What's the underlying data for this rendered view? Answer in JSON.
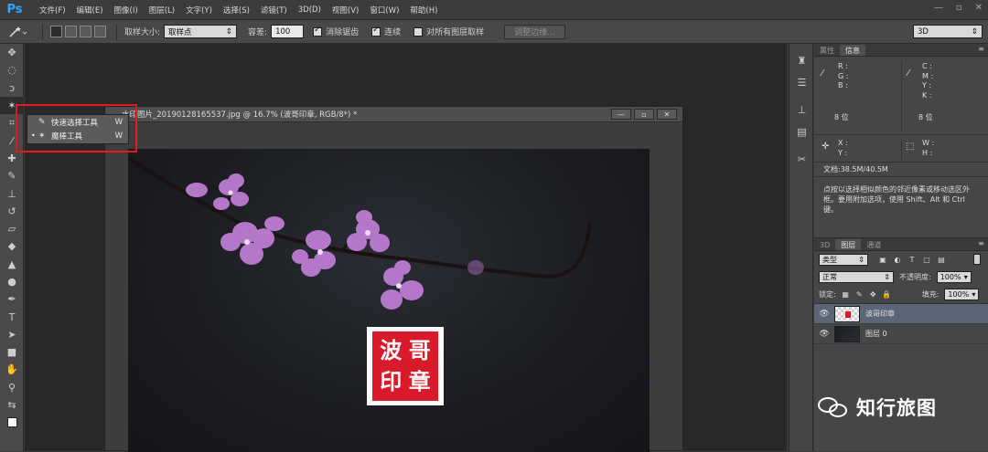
{
  "app": {
    "logo": "Ps"
  },
  "menubar": {
    "items": [
      "文件(F)",
      "编辑(E)",
      "图像(I)",
      "图层(L)",
      "文字(Y)",
      "选择(S)",
      "滤镜(T)",
      "3D(D)",
      "视图(V)",
      "窗口(W)",
      "帮助(H)"
    ],
    "window_controls": {
      "minimize": "—",
      "restore": "▫",
      "close": "✕"
    }
  },
  "options_bar": {
    "tool_icon": "magic-wand-icon",
    "sample_size_label": "取样大小:",
    "sample_size_value": "取样点",
    "tolerance_label": "容差:",
    "tolerance_value": "100",
    "anti_alias_label": "消除锯齿",
    "anti_alias_checked": true,
    "contiguous_label": "连续",
    "contiguous_checked": true,
    "sample_all_layers_label": "对所有图层取样",
    "sample_all_layers_checked": false,
    "refine_edge_label": "调整边缘...",
    "workspace_value": "3D"
  },
  "tool_flyout": {
    "items": [
      {
        "label": "快速选择工具",
        "shortcut": "W",
        "icon": "quick-selection-icon",
        "selected": false
      },
      {
        "label": "魔棒工具",
        "shortcut": "W",
        "icon": "magic-wand-icon",
        "selected": true
      }
    ]
  },
  "document": {
    "title": "水印图片_20190128165537.jpg @ 16.7% (波哥印章, RGB/8*) *",
    "seal_chars": [
      "波",
      "哥",
      "印",
      "章"
    ],
    "colors": {
      "seal": "#d91a2a",
      "layer_selected": "#5a6575"
    }
  },
  "info_panel": {
    "tabs": [
      "属性",
      "信息"
    ],
    "active_tab": "信息",
    "rgb_labels": [
      "R :",
      "G :",
      "B :"
    ],
    "cmyk_labels": [
      "C :",
      "M :",
      "Y :",
      "K :"
    ],
    "bit_depth_left": "8 位",
    "bit_depth_right": "8 位",
    "xy_labels": [
      "X :",
      "Y :"
    ],
    "wh_labels": [
      "W :",
      "H :"
    ],
    "doc_size": "文档:38.5M/40.5M",
    "hint": "点按以选择相似颜色的邻近像素或移动选区外框。要用附加选项，使用 Shift、Alt 和 Ctrl 键。"
  },
  "layers_panel": {
    "tabs": [
      "3D",
      "图层",
      "通道"
    ],
    "active_tab": "图层",
    "filter_value": "类型",
    "blend_mode": "正常",
    "opacity_label": "不透明度:",
    "opacity_value": "100%",
    "lock_label": "锁定:",
    "fill_label": "填充:",
    "fill_value": "100%",
    "layers": [
      {
        "name": "波哥印章",
        "selected": true
      },
      {
        "name": "图层 0",
        "selected": false
      }
    ]
  },
  "watermark": {
    "text": "知行旅图"
  }
}
